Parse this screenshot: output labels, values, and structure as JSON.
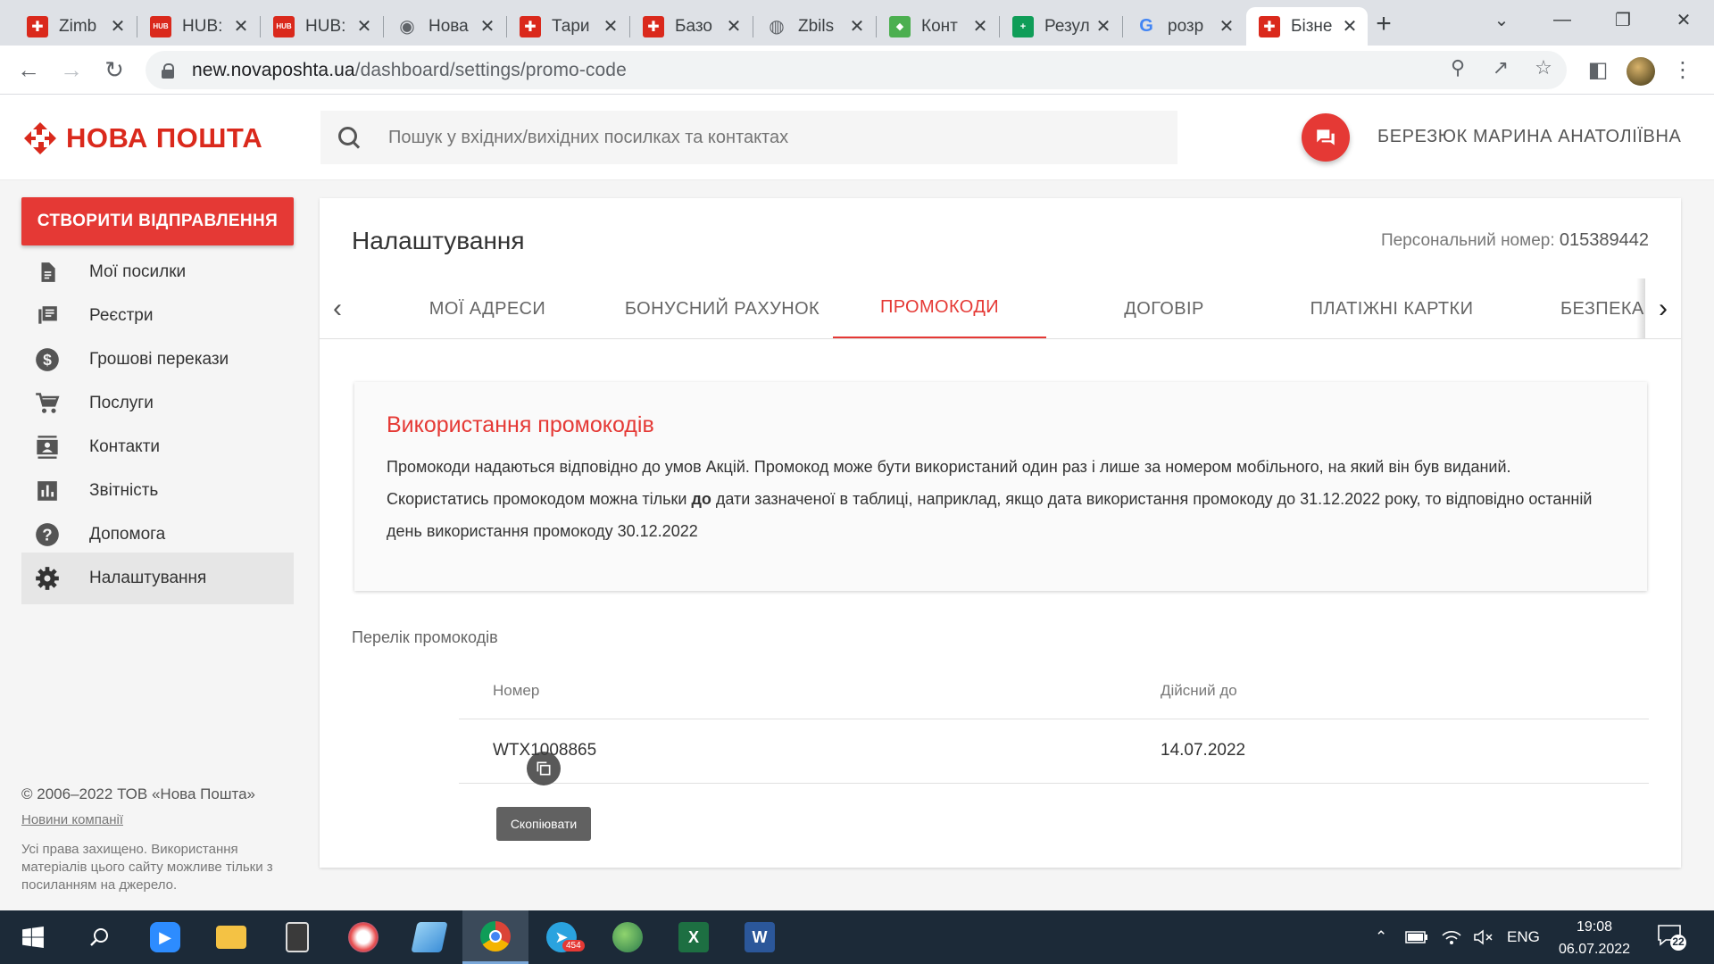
{
  "browser": {
    "tabs": [
      {
        "title": "Zimb",
        "favicon": "novaposhta-icon",
        "color": "#da291c"
      },
      {
        "title": "HUB:",
        "favicon": "hub-icon",
        "color": "#da291c"
      },
      {
        "title": "HUB:",
        "favicon": "hub-icon",
        "color": "#da291c"
      },
      {
        "title": "Нова",
        "favicon": "chrome-icon",
        "color": "#5f6368"
      },
      {
        "title": "Тари",
        "favicon": "novaposhta-icon",
        "color": "#da291c"
      },
      {
        "title": "Базо",
        "favicon": "novaposhta-icon",
        "color": "#da291c"
      },
      {
        "title": "Zbils",
        "favicon": "globe-icon",
        "color": "#5f6368"
      },
      {
        "title": "Конт",
        "favicon": "colorful-icon",
        "color": "#4caf50"
      },
      {
        "title": "Резул",
        "favicon": "plus-icon",
        "color": "#0f9d58"
      },
      {
        "title": "розр",
        "favicon": "google-icon",
        "color": "#4285f4"
      },
      {
        "title": "Бізне",
        "favicon": "novaposhta-icon",
        "color": "#da291c",
        "active": true
      }
    ],
    "url_host": "new.novaposhta.ua",
    "url_path": "/dashboard/settings/promo-code"
  },
  "header": {
    "logo_text": "НОВА ПОШТА",
    "search_placeholder": "Пошук у вхідних/вихідних посилках та контактах",
    "user_name": "БЕРЕЗЮК МАРИНА АНАТОЛІЇВНА",
    "accent_color": "#e53935"
  },
  "sidebar": {
    "create_button": "СТВОРИТИ ВІДПРАВЛЕННЯ",
    "items": [
      {
        "label": "Мої посилки",
        "icon": "document-icon"
      },
      {
        "label": "Реєстри",
        "icon": "list-icon"
      },
      {
        "label": "Грошові перекази",
        "icon": "dollar-icon"
      },
      {
        "label": "Послуги",
        "icon": "cart-icon"
      },
      {
        "label": "Контакти",
        "icon": "contacts-icon"
      },
      {
        "label": "Звітність",
        "icon": "chart-icon"
      },
      {
        "label": "Допомога",
        "icon": "help-icon"
      },
      {
        "label": "Налаштування",
        "icon": "gear-icon",
        "active": true
      }
    ],
    "copyright": "© 2006–2022 ТОВ «Нова Пошта»",
    "news_link": "Новини компанії",
    "rights": "Усі права захищено. Використання матеріалів цього сайту можливе тільки з посиланням на джерело."
  },
  "main": {
    "title": "Налаштування",
    "personal_label": "Персональний номер:",
    "personal_number": "015389442",
    "tabs": [
      {
        "label": "МОЇ АДРЕСИ"
      },
      {
        "label": "БОНУСНИЙ РАХУНОК"
      },
      {
        "label": "ПРОМОКОДИ",
        "active": true
      },
      {
        "label": "ДОГОВІР"
      },
      {
        "label": "ПЛАТІЖНІ КАРТКИ"
      },
      {
        "label": "БЕЗПЕКА"
      }
    ],
    "info": {
      "title": "Використання промокодів",
      "text_1": "Промокоди надаються відповідно до умов Акцій. Промокод може бути використаний один раз і лише за номером мобільного, на який він був виданий. Скористатись промокодом можна тільки ",
      "text_bold": "до",
      "text_2": " дати зазначеної в таблиці, наприклад, якщо дата використання промокоду до 31.12.2022 року, то відповідно останній день використання промокоду 30.12.2022"
    },
    "list_title": "Перелік промокодів",
    "table": {
      "col_number": "Номер",
      "col_valid": "Дійсний до",
      "rows": [
        {
          "code": "WTX1008865",
          "valid_until": "14.07.2022"
        }
      ]
    },
    "tooltip": "Скопіювати"
  },
  "taskbar": {
    "language": "ENG",
    "time": "19:08",
    "date": "06.07.2022",
    "telegram_badge": "454",
    "notifications": "22"
  }
}
